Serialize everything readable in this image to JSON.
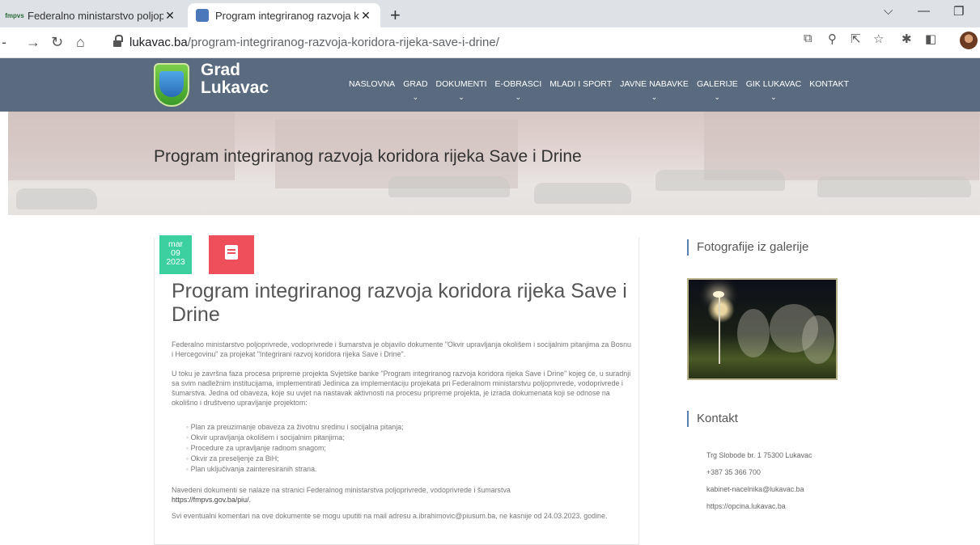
{
  "browser": {
    "tabs": [
      {
        "title": "Federalno ministarstvo poljoprivr",
        "favicon": "fmpvs",
        "active": false
      },
      {
        "title": "Program integriranog razvoja ko",
        "active": true
      }
    ],
    "new_tab": "+",
    "url_domain": "lukavac.ba",
    "url_path": "/program-integriranog-razvoja-koridora-rijeka-save-i-drine/"
  },
  "site": {
    "logo_line1": "Grad",
    "logo_line2": "Lukavac",
    "nav": [
      "NASLOVNA",
      "GRAD",
      "DOKUMENTI",
      "E-OBRASCI",
      "MLADI I SPORT",
      "JAVNE NABAVKE",
      "GALERIJE",
      "GIK LUKAVAC",
      "KONTAKT"
    ],
    "hero_title": "Program integriranog razvoja koridora rijeka Save i Drine"
  },
  "article": {
    "date_month": "mar",
    "date_day": "09",
    "date_year": "2023",
    "title": "Program integriranog razvoja koridora rijeka Save i Drine",
    "p1": "Federalno ministarstvo poljoprivrede, vodoprivrede i šumarstva je objavilo dokumente \"Okvir upravljanja okolišem i socijalnim pitanjima za Bosnu i Hercegovinu\" za projekat \"Integrirani razvoj koridora rijeka Save i Drine\".",
    "p2": "U toku je završna faza procesa pripreme projekta Svjetske banke \"Program integriranog razvoja koridora rijeka Save i Drine\" kojeg će, u suradnji sa svim nadležnim institucijama, implementirati Jedinica za implementaciju projekata pri Federalnom ministarstvu poljoprivrede, vodoprivrede i šumarstva. Jedna od obaveza, koje su uvjet na nastavak aktivnosti na procesu pripreme projekta, je izrada dokumenata koji se odnose na okolišno i društveno upravljanje projektom:",
    "bullets": [
      "Plan za preuzimanje obaveza za životnu sredinu i socijalna pitanja;",
      "Okvir upravljanja okolišem i socijalnim pitanjima;",
      "Procedure za upravljanje radnom snagom;",
      "Okvir za preseljenje za BiH;",
      "Plan uključivanja zainteresiranih strana."
    ],
    "p3": "Navedeni dokumenti se nalaze na stranici Federalnog ministarstva poljoprivrede, vodoprivrede i šumarstva",
    "p3_link": "https://fmpvs.gov.ba/piu/.",
    "p4": " Svi eventualni komentari na ove dokumente se mogu uputiti na mail adresu a.ibrahimovic@piusum.ba, ne kasnije od 24.03.2023. godine."
  },
  "sidebar": {
    "gallery_heading": "Fotografije iz galerije",
    "contact_heading": "Kontakt",
    "contact_lines": [
      "Trg Slobode br. 1 75300 Lukavac",
      "+387 35 366 700",
      "kabinet-nacelnika@lukavac.ba",
      "https://opcina.lukavac.ba"
    ]
  },
  "colors": {
    "header_bg": "#5a6b80",
    "date_badge": "#3ccfa0",
    "type_badge": "#ef4f5a",
    "accent_line": "#5a7fb0"
  }
}
